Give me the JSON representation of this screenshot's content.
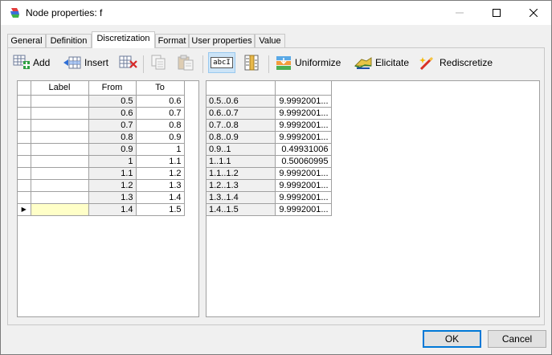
{
  "window": {
    "title": "Node properties: f"
  },
  "tabs": [
    {
      "label": "General"
    },
    {
      "label": "Definition"
    },
    {
      "label": "Discretization"
    },
    {
      "label": "Format"
    },
    {
      "label": "User properties"
    },
    {
      "label": "Value"
    }
  ],
  "active_tab": "Discretization",
  "toolbar": {
    "add_label": "Add",
    "insert_label": "Insert",
    "uniformize_label": "Uniformize",
    "elicitate_label": "Elicitate",
    "rediscretize_label": "Rediscretize",
    "label_mode_text": "abcI"
  },
  "intervals_grid": {
    "columns": [
      "Label",
      "From",
      "To"
    ],
    "rows": [
      {
        "label": "",
        "from": "0.5",
        "to": "0.6"
      },
      {
        "label": "",
        "from": "0.6",
        "to": "0.7"
      },
      {
        "label": "",
        "from": "0.7",
        "to": "0.8"
      },
      {
        "label": "",
        "from": "0.8",
        "to": "0.9"
      },
      {
        "label": "",
        "from": "0.9",
        "to": "1"
      },
      {
        "label": "",
        "from": "1",
        "to": "1.1"
      },
      {
        "label": "",
        "from": "1.1",
        "to": "1.2"
      },
      {
        "label": "",
        "from": "1.2",
        "to": "1.3"
      },
      {
        "label": "",
        "from": "1.3",
        "to": "1.4"
      },
      {
        "label": "",
        "from": "1.4",
        "to": "1.5"
      }
    ],
    "current_row_marker": "▶"
  },
  "values_grid": {
    "columns": [
      "",
      ""
    ],
    "rows": [
      {
        "interval": "0.5..0.6",
        "value": "9.9992001..."
      },
      {
        "interval": "0.6..0.7",
        "value": "9.9992001..."
      },
      {
        "interval": "0.7..0.8",
        "value": "9.9992001..."
      },
      {
        "interval": "0.8..0.9",
        "value": "9.9992001..."
      },
      {
        "interval": "0.9..1",
        "value": "0.49931006"
      },
      {
        "interval": "1..1.1",
        "value": "0.50060995"
      },
      {
        "interval": "1.1..1.2",
        "value": "9.9992001..."
      },
      {
        "interval": "1.2..1.3",
        "value": "9.9992001..."
      },
      {
        "interval": "1.3..1.4",
        "value": "9.9992001..."
      },
      {
        "interval": "1.4..1.5",
        "value": "9.9992001..."
      }
    ]
  },
  "buttons": {
    "ok_label": "OK",
    "cancel_label": "Cancel"
  },
  "colors": {
    "accent": "#0078d7",
    "selected_cell": "#ffffc8",
    "grid_line": "#a0a0a0"
  }
}
